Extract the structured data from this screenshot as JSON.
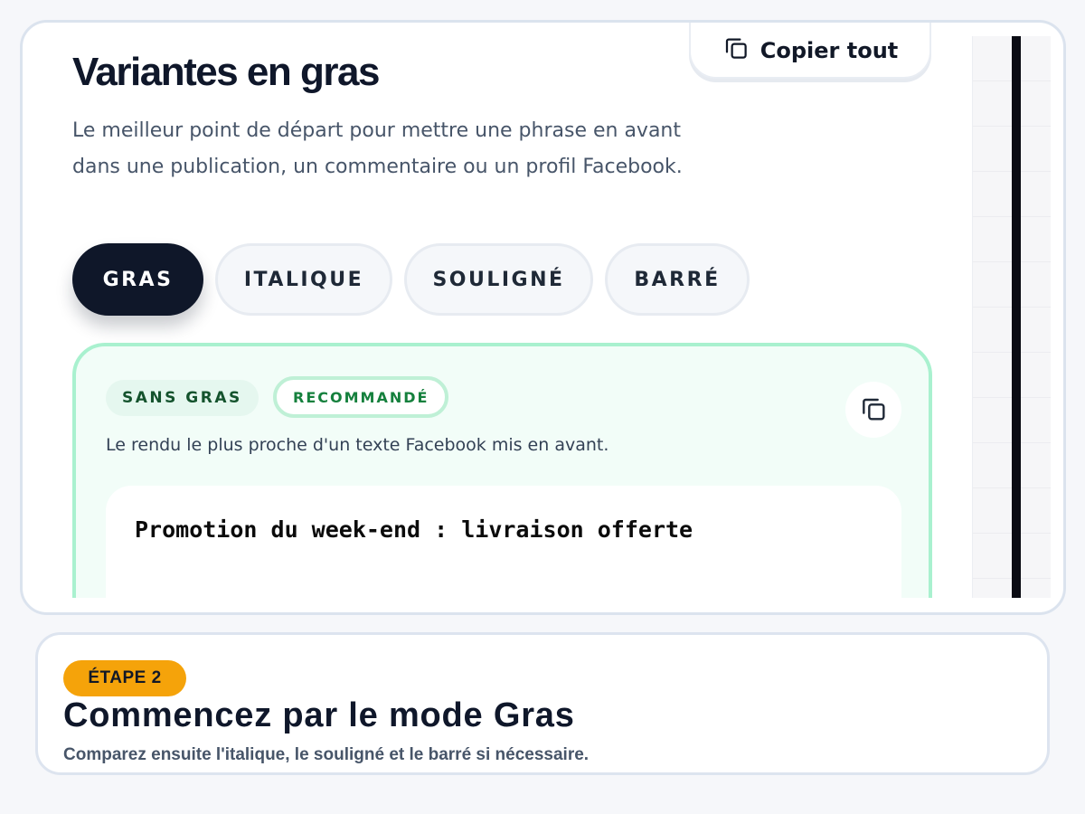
{
  "toolbar": {
    "copy_all_label": "Copier tout",
    "copy_icon": "copy-icon"
  },
  "section": {
    "title": "Variantes en gras",
    "description": "Le meilleur point de départ pour mettre une phrase en avant dans une publication, un commentaire ou un profil Facebook."
  },
  "tabs": [
    {
      "label": "GRAS",
      "active": true
    },
    {
      "label": "ITALIQUE",
      "active": false
    },
    {
      "label": "SOULIGNÉ",
      "active": false
    },
    {
      "label": "BARRÉ",
      "active": false
    }
  ],
  "variant": {
    "badge_primary": "SANS GRAS",
    "badge_secondary": "RECOMMANDÉ",
    "description": "Le rendu le plus proche d'un texte Facebook mis en avant.",
    "preview_text": "Promotion du week-end : livraison offerte",
    "copy_icon": "copy-icon"
  },
  "step": {
    "badge": "ÉTAPE 2",
    "title": "Commencez par le mode Gras",
    "subtitle": "Comparez ensuite l'italique, le souligné et le barré si nécessaire."
  },
  "colors": {
    "page_background": "#f6f7fa",
    "tab_active": "#0f1729",
    "tab_inactive": "#f5f7fa",
    "card_background": "#f2fdf8",
    "card_border": "#a9f1cf",
    "badge_green_text": "#15803d",
    "step_badge": "#f5a30a"
  }
}
